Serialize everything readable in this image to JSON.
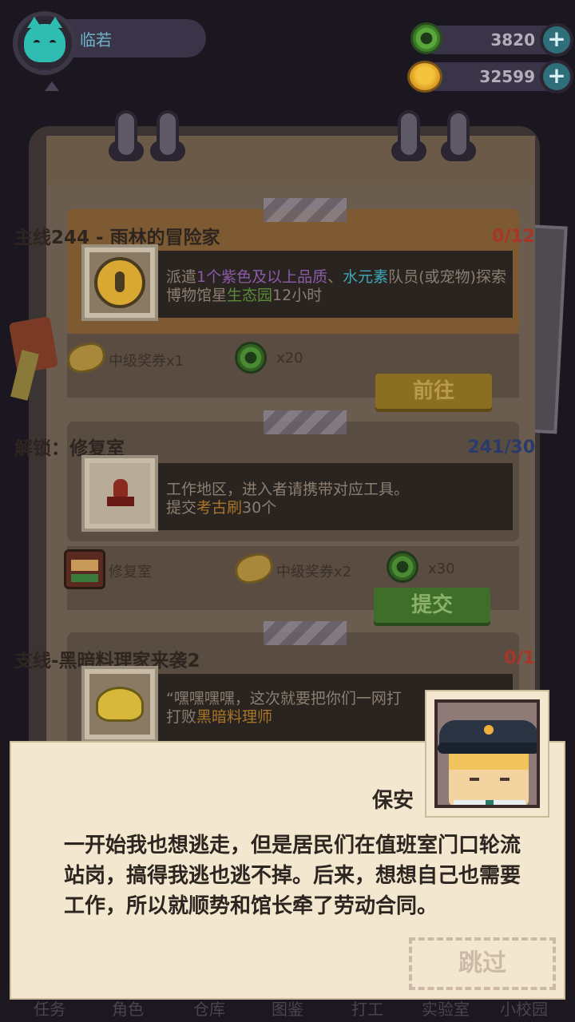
{
  "player": {
    "name": "临若"
  },
  "currency": {
    "gems": {
      "value": "3820",
      "icon": "green-coin-icon"
    },
    "gold": {
      "value": "32599",
      "icon": "gold-coin-icon"
    }
  },
  "quests": [
    {
      "title": "主线244 - 雨林的冒险家",
      "progress": "0/12",
      "progress_color": "#a8352a",
      "desc_parts": [
        "派遣",
        "1个紫色及以上品质",
        "、",
        "水元素",
        "队员(或宠物)探索博物馆星",
        "生态园",
        "12小时"
      ],
      "rewards": [
        {
          "icon": "ticket-icon",
          "label": "中级奖券x1"
        },
        {
          "icon": "green-coin-icon",
          "label": "x20"
        }
      ],
      "button": "前往"
    },
    {
      "title": "解锁：修复室",
      "progress": "241/30",
      "progress_color": "#2a3a6a",
      "desc_line1": "工作地区，进入者请携带对应工具。",
      "desc_parts": [
        "提交",
        "考古刷",
        "30个"
      ],
      "rewards": [
        {
          "icon": "repair-room-icon",
          "label": "修复室"
        },
        {
          "icon": "ticket-icon",
          "label": "中级奖券x2"
        },
        {
          "icon": "green-coin-icon",
          "label": "x30"
        }
      ],
      "button": "提交"
    },
    {
      "title": "支线-黑暗料理家来袭2",
      "progress": "0/1",
      "progress_color": "#a8352a",
      "desc_line1": "“嘿嘿嘿嘿，这次就要把你们一网打",
      "desc_parts": [
        "打败",
        "黑暗料理师"
      ]
    }
  ],
  "dialog": {
    "speaker": "保安",
    "text": "一开始我也想逃走，但是居民们在值班室门口轮流站岗，搞得我逃也逃不掉。后来，想想自己也需要工作，所以就顺势和馆长牵了劳动合同。",
    "skip": "跳过"
  },
  "nav": [
    "任务",
    "角色",
    "仓库",
    "图鉴",
    "打工",
    "实验室",
    "小校园"
  ]
}
